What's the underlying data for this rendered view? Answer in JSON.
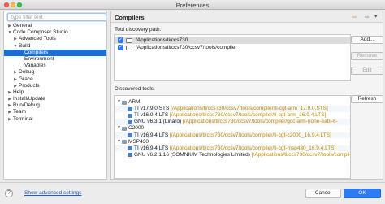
{
  "window": {
    "title": "Preferences"
  },
  "filter": {
    "placeholder": "type filter text"
  },
  "tree": [
    {
      "label": "General",
      "arrow": "▶",
      "indent": 1
    },
    {
      "label": "Code Composer Studio",
      "arrow": "▼",
      "indent": 1
    },
    {
      "label": "Advanced Tools",
      "arrow": "▶",
      "indent": 2
    },
    {
      "label": "Build",
      "arrow": "▼",
      "indent": 2
    },
    {
      "label": "Compilers",
      "arrow": "",
      "indent": 3,
      "selected": true
    },
    {
      "label": "Environment",
      "arrow": "",
      "indent": 3
    },
    {
      "label": "Variables",
      "arrow": "",
      "indent": 3
    },
    {
      "label": "Debug",
      "arrow": "▶",
      "indent": 2
    },
    {
      "label": "Grace",
      "arrow": "▶",
      "indent": 2
    },
    {
      "label": "Products",
      "arrow": "▶",
      "indent": 2
    },
    {
      "label": "Help",
      "arrow": "▶",
      "indent": 1
    },
    {
      "label": "Install/Update",
      "arrow": "▶",
      "indent": 1
    },
    {
      "label": "Run/Debug",
      "arrow": "▶",
      "indent": 1
    },
    {
      "label": "Team",
      "arrow": "▶",
      "indent": 1
    },
    {
      "label": "Terminal",
      "arrow": "▶",
      "indent": 1
    }
  ],
  "page": {
    "title": "Compilers",
    "nav": {
      "back": "⇦",
      "forward": "⇨",
      "menu": "▾"
    },
    "discovery_label": "Tool discovery path:",
    "paths": [
      {
        "text": "/Applications/ti/ccs730"
      },
      {
        "text": "/Applications/ti/ccs730/ccsv7/tools/compiler"
      }
    ],
    "path_buttons": {
      "add": "Add...",
      "remove": "Remove",
      "edit": "Edit"
    },
    "discovered_label": "Discovered tools:",
    "refresh": "Refresh",
    "tools": [
      {
        "name": "ARM",
        "level": 0,
        "path": ""
      },
      {
        "name": "TI v17.9.0.STS",
        "level": 1,
        "path": "[/Applications/ti/ccs730/ccsv7/tools/compiler/ti-cgt-arm_17.9.0.STS]"
      },
      {
        "name": "TI v16.9.4.LTS",
        "level": 1,
        "path": "[/Applications/ti/ccs730/ccsv7/tools/compiler/ti-cgt-arm_16.9.4.LTS]"
      },
      {
        "name": "GNU v6.3.1 (Linaro)",
        "level": 1,
        "path": "[/Applications/ti/ccs730/ccsv7/tools/compiler/gcc-arm-none-eabi-6-"
      },
      {
        "name": "C2000",
        "level": 0,
        "path": ""
      },
      {
        "name": "TI v16.9.4.LTS",
        "level": 1,
        "path": "[/Applications/ti/ccs730/ccsv7/tools/compiler/ti-cgt-c2000_16.9.4.LTS]"
      },
      {
        "name": "MSP430",
        "level": 0,
        "path": ""
      },
      {
        "name": "TI v16.9.4.LTS",
        "level": 1,
        "path": "[/Applications/ti/ccs730/ccsv7/tools/compiler/ti-cgt-msp430_16.9.4.LTS]"
      },
      {
        "name": "GNU v6.2.1.16 (SOMNIUM Technologies Limited)",
        "level": 1,
        "path": "[/Applications/ti/ccs730/ccsv7/tools/compiler"
      }
    ]
  },
  "footer": {
    "help": "?",
    "advanced_link": "Show advanced settings",
    "cancel": "Cancel",
    "ok": "OK"
  }
}
